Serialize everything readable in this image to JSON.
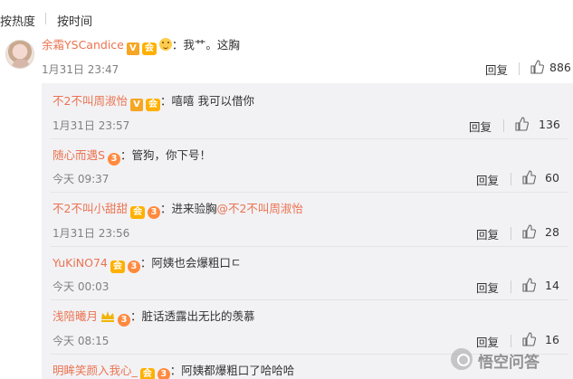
{
  "sort": {
    "hot": "按热度",
    "time": "按时间"
  },
  "main_comment": {
    "user": "余霜YSCandice",
    "text": "：我艹。这胸",
    "time": "1月31日 23:47",
    "reply_label": "回复",
    "likes": "886"
  },
  "replies": [
    {
      "user": "不2不叫周淑怡",
      "text": "：嘻嘻 我可以借你",
      "mention": "",
      "time": "1月31日 23:57",
      "reply_label": "回复",
      "likes": "136"
    },
    {
      "user": "随心而遇S",
      "text": "：管狗，你下号！",
      "mention": "",
      "time": "今天 09:37",
      "reply_label": "回复",
      "likes": "60"
    },
    {
      "user": "不2不叫小甜甜",
      "text": "：进来验胸",
      "mention": "@不2不叫周淑怡",
      "time": "1月31日 23:56",
      "reply_label": "回复",
      "likes": "28"
    },
    {
      "user": "YuKiNO74",
      "text": "：阿姨也会爆粗口ㄷ",
      "mention": "",
      "time": "今天 00:03",
      "reply_label": "回复",
      "likes": "14"
    },
    {
      "user": "浅陪曦月",
      "text": "：脏话透露出无比的羡慕",
      "mention": "",
      "time": "今天 08:15",
      "reply_label": "回复",
      "likes": "16"
    },
    {
      "user": "明眸笑颜入我心_",
      "text": "：阿姨都爆粗口了哈哈哈",
      "mention": "",
      "time": "",
      "reply_label": "",
      "likes": ""
    }
  ],
  "watermark": {
    "text": "悟空问答"
  },
  "colors": {
    "username": "#eb7350",
    "reply_bg": "#f2f2f5",
    "meta": "#808080"
  }
}
